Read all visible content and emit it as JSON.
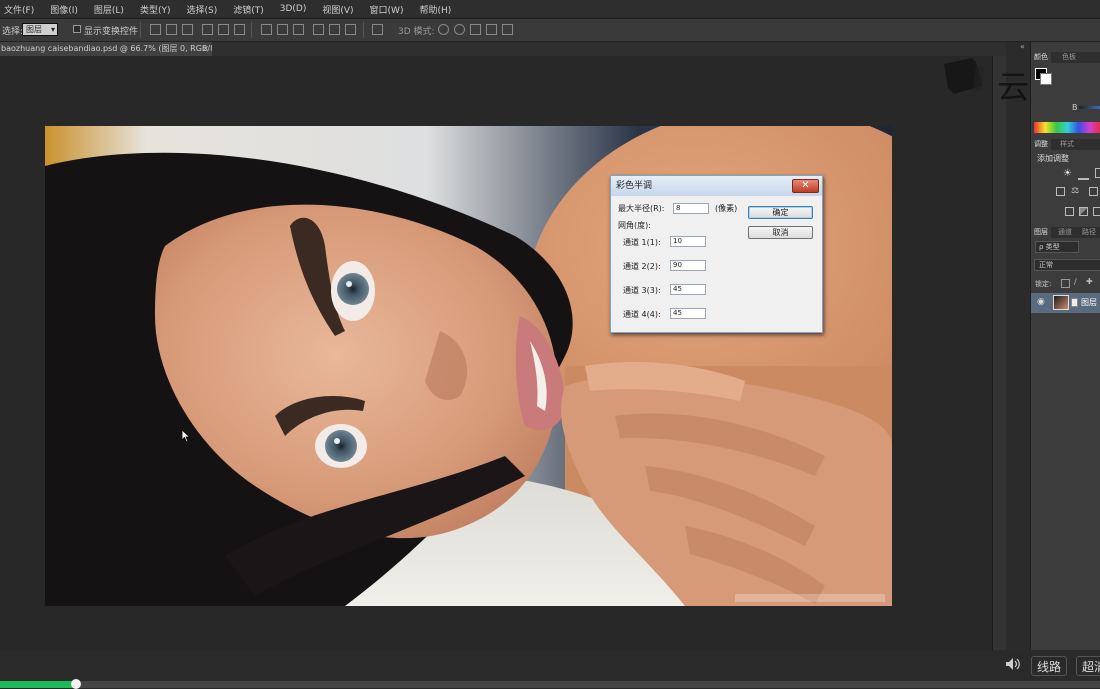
{
  "menu": {
    "items": [
      "文件(F)",
      "图像(I)",
      "图层(L)",
      "类型(Y)",
      "选择(S)",
      "滤镜(T)",
      "3D(D)",
      "视图(V)",
      "窗口(W)",
      "帮助(H)"
    ]
  },
  "options_bar": {
    "auto_select_label": "选择:",
    "auto_select_value": "图层",
    "show_transform_label": "显示变换控件",
    "mode_3d_label": "3D 模式:"
  },
  "document": {
    "tab_title": "baozhuang caisebandiao.psd @ 66.7% (图层 0, RGB/8#)",
    "close_glyph": "×"
  },
  "watermark": {
    "text": "云课堂"
  },
  "panels": {
    "color_tabs": [
      "颜色",
      "色板"
    ],
    "color_channel": "B",
    "adjust_tabs": [
      "调整",
      "样式"
    ],
    "adjust_heading": "添加调整",
    "layers_tabs": [
      "图层",
      "通道",
      "路径"
    ],
    "layer_filter": "ρ 类型",
    "blend_mode": "正常",
    "lock_label": "锁定:",
    "layer_name": "图层"
  },
  "dialog": {
    "title": "彩色半调",
    "close_glyph": "✕",
    "max_radius_label": "最大半径(R):",
    "max_radius_value": "8",
    "max_radius_unit": "(像素)",
    "angles_label": "网角(度):",
    "channels": [
      {
        "label": "通道 1(1):",
        "value": "10"
      },
      {
        "label": "通道 2(2):",
        "value": "90"
      },
      {
        "label": "通道 3(3):",
        "value": "45"
      },
      {
        "label": "通道 4(4):",
        "value": "45"
      }
    ],
    "ok_label": "确定",
    "cancel_label": "取消"
  },
  "player": {
    "route_label": "线路",
    "quality_label": "超清",
    "progress_fraction": 0.069
  }
}
